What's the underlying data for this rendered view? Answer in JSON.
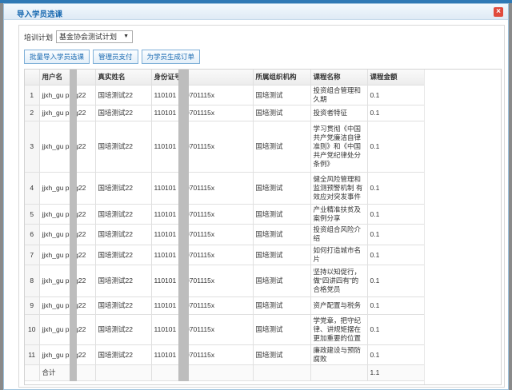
{
  "dialog": {
    "title": "导入学员选课",
    "close_symbol": "×"
  },
  "filter": {
    "label": "培训计划",
    "selected": "基金协会测试计划"
  },
  "toolbar": {
    "import_label": "批量导入学员选课",
    "admin_pay_label": "管理员支付",
    "generate_order_label": "为学员生成订单"
  },
  "table": {
    "columns": [
      "用户名",
      "真实姓名",
      "身份证号",
      "所属组织机构",
      "课程名称",
      "课程金额"
    ],
    "rows": [
      {
        "num": "1",
        "user": "jjxh_gu  ping22",
        "name": "国培测试22",
        "id": "110101   050701115x",
        "org": "国培测试",
        "course": "投资组合管理和久期",
        "amount": "0.1"
      },
      {
        "num": "2",
        "user": "jjxh_gu  ping22",
        "name": "国培测试22",
        "id": "110101   050701115x",
        "org": "国培测试",
        "course": "投资者特征",
        "amount": "0.1"
      },
      {
        "num": "3",
        "user": "jjxh_gu  ping22",
        "name": "国培测试22",
        "id": "110101   050701115x",
        "org": "国培测试",
        "course": "学习贯彻《中国共产党廉洁自律准则》和《中国共产党纪律处分条例》",
        "amount": "0.1"
      },
      {
        "num": "4",
        "user": "jjxh_gu  ping22",
        "name": "国培测试22",
        "id": "110101   050701115x",
        "org": "国培测试",
        "course": "健全风险管理和监测预警机制 有效应对突发事件",
        "amount": "0.1"
      },
      {
        "num": "5",
        "user": "jjxh_gu  ping22",
        "name": "国培测试22",
        "id": "110101   050701115x",
        "org": "国培测试",
        "course": "产业精准扶贫及案例分享",
        "amount": "0.1"
      },
      {
        "num": "6",
        "user": "jjxh_gu  ping22",
        "name": "国培测试22",
        "id": "110101   050701115x",
        "org": "国培测试",
        "course": "投资组合风险介绍",
        "amount": "0.1"
      },
      {
        "num": "7",
        "user": "jjxh_gu  ping22",
        "name": "国培测试22",
        "id": "110101   050701115x",
        "org": "国培测试",
        "course": "如何打造城市名片",
        "amount": "0.1"
      },
      {
        "num": "8",
        "user": "jjxh_gu  ping22",
        "name": "国培测试22",
        "id": "110101   050701115x",
        "org": "国培测试",
        "course": "坚持以知促行，做“四讲四有”的合格党员",
        "amount": "0.1"
      },
      {
        "num": "9",
        "user": "jjxh_gu  ping22",
        "name": "国培测试22",
        "id": "110101   050701115x",
        "org": "国培测试",
        "course": "资产配置与税务",
        "amount": "0.1"
      },
      {
        "num": "10",
        "user": "jjxh_gu  ping22",
        "name": "国培测试22",
        "id": "110101   050701115x",
        "org": "国培测试",
        "course": "学党章，把守纪律、讲规矩摆在更加重要的位置",
        "amount": "0.1"
      },
      {
        "num": "11",
        "user": "jjxh_gu  ping22",
        "name": "国培测试22",
        "id": "110101   050701115x",
        "org": "国培测试",
        "course": "廉政建设与预防腐败",
        "amount": "0.1"
      }
    ],
    "footer": {
      "label": "合计",
      "total": "1.1"
    }
  }
}
